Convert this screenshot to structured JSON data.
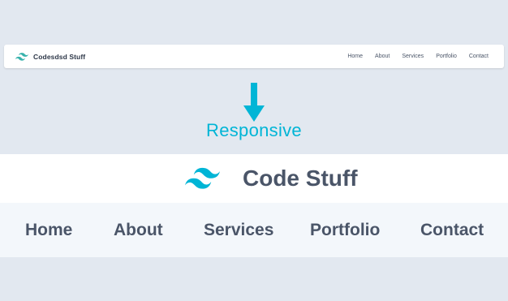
{
  "desktop_nav": {
    "brand": "Codesdsd Stuff",
    "links": [
      "Home",
      "About",
      "Services",
      "Portfolio",
      "Contact"
    ]
  },
  "arrow": {
    "icon": "arrow-down-icon",
    "label": "Responsive"
  },
  "mobile_nav": {
    "brand": "Code Stuff",
    "links": [
      "Home",
      "About",
      "Services",
      "Portfolio",
      "Contact"
    ]
  },
  "colors": {
    "background": "#e2e8f0",
    "accent": "#00b5d6",
    "text": "#4a5568",
    "nav_row_bg": "#f3f7fb"
  }
}
